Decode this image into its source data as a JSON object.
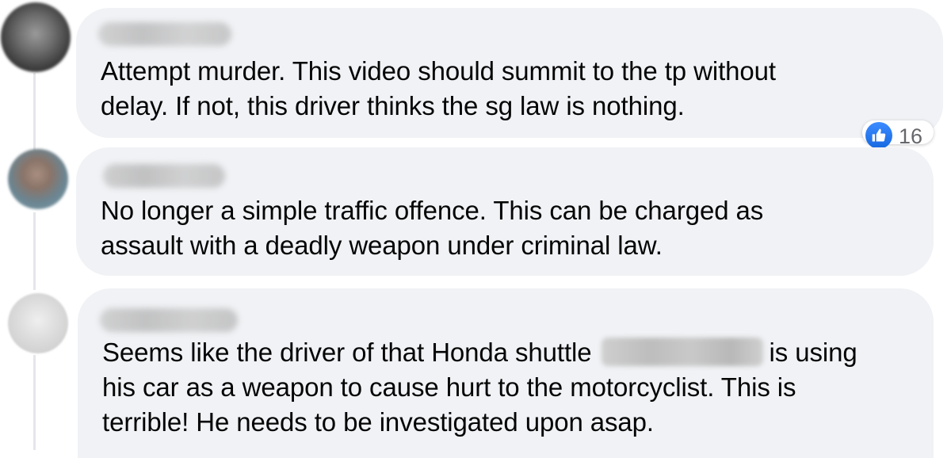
{
  "comments": [
    {
      "text_lines": [
        "Attempt murder. This video should summit to the tp without",
        "delay. If not, this driver thinks the sg law is nothing."
      ],
      "reaction": {
        "icon": "like-icon",
        "count": "16"
      }
    },
    {
      "text_lines": [
        "No longer a simple traffic offence. This can be charged as",
        "assault with a deadly weapon under criminal law."
      ]
    },
    {
      "text_lines_before": "Seems like the driver of that Honda shuttle",
      "text_lines_after": "is using",
      "text_lines": [
        "his car as a weapon to cause hurt to the motorcyclist. This is",
        "terrible! He needs to be investigated upon asap."
      ]
    }
  ],
  "colors": {
    "bubble": "#f0f2f5",
    "text": "#050505",
    "like_blue": "#1877f2",
    "secondary_text": "#65676b"
  }
}
